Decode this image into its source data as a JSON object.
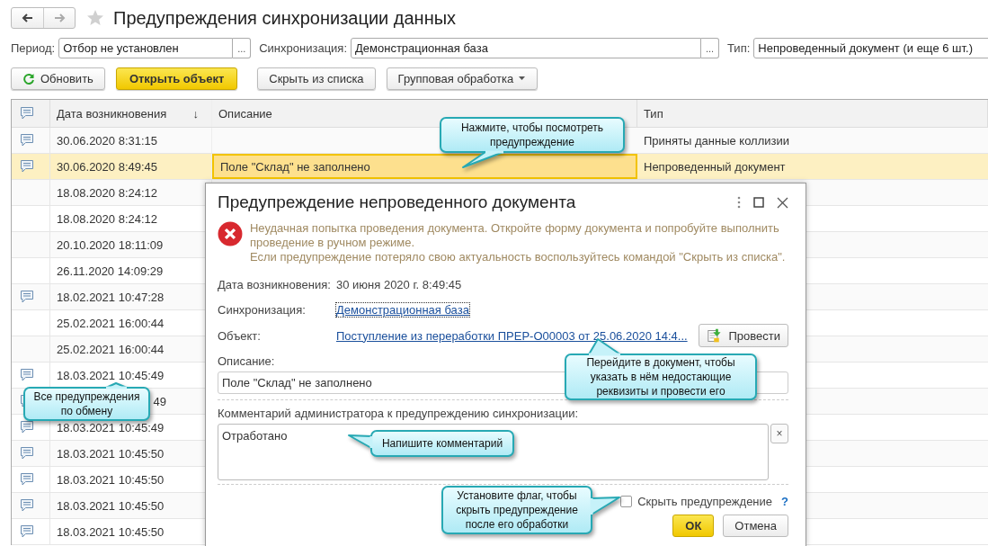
{
  "nav_buttons": [
    {
      "kind": "back",
      "disabled": false
    },
    {
      "kind": "forward",
      "disabled": true
    }
  ],
  "title": "Предупреждения синхронизации данных",
  "filters": [
    {
      "label": "Период:",
      "value": "Отбор не установлен",
      "picker": "..."
    },
    {
      "label": "Синхронизация:",
      "value": "Демонстрационная база",
      "picker": "..."
    },
    {
      "label": "Тип:",
      "value": "Непроведенный документ (и еще 6 шт.)"
    }
  ],
  "toolbar": [
    {
      "label": "Обновить",
      "kind": "refresh"
    },
    {
      "label": "Открыть объект",
      "kind": "default"
    },
    {
      "label": "Скрыть из списка",
      "kind": "plain"
    },
    {
      "label": "Групповая обработка",
      "kind": "dropdown"
    }
  ],
  "table": {
    "columns": [
      {
        "kind": "icon"
      },
      {
        "kind": "text",
        "label": "Дата возникновения",
        "sort_mark": "↓"
      },
      {
        "kind": "text",
        "label": "Описание"
      },
      {
        "kind": "text",
        "label": "Тип"
      }
    ],
    "rows": [
      {
        "kind": "full",
        "has_comment": true,
        "date": "30.06.2020 8:31:15",
        "type": "Приняты данные коллизии",
        "selected": false
      },
      {
        "kind": "full",
        "has_comment": true,
        "date": "30.06.2020 8:49:45",
        "description": "Поле \"Склад\" не заполнено",
        "type": "Непроведенный документ",
        "selected": true
      },
      {
        "kind": "full",
        "has_comment": false,
        "date": "18.08.2020 8:24:12",
        "selected": false
      },
      {
        "kind": "full",
        "has_comment": false,
        "date": "18.08.2020 8:24:12",
        "selected": false
      },
      {
        "kind": "full",
        "has_comment": false,
        "date": "20.10.2020 18:11:09",
        "selected": false
      },
      {
        "kind": "full",
        "has_comment": false,
        "date": "26.11.2020 14:09:29",
        "selected": false
      },
      {
        "kind": "full",
        "has_comment": true,
        "date": "18.02.2021 10:47:28",
        "selected": false
      },
      {
        "kind": "full",
        "has_comment": false,
        "date": "25.02.2021 16:00:44",
        "selected": false
      },
      {
        "kind": "full",
        "has_comment": false,
        "date": "25.02.2021 16:00:44",
        "selected": false
      },
      {
        "kind": "full",
        "has_comment": true,
        "date": "18.03.2021 10:45:49",
        "selected": false
      },
      {
        "kind": "covered",
        "has_comment": true,
        "date": "49",
        "selected": false
      },
      {
        "kind": "full",
        "has_comment": true,
        "date": "18.03.2021 10:45:49",
        "selected": false
      },
      {
        "kind": "full",
        "has_comment": true,
        "date": "18.03.2021 10:45:50",
        "selected": false
      },
      {
        "kind": "full",
        "has_comment": true,
        "date": "18.03.2021 10:45:50",
        "selected": false
      },
      {
        "kind": "full",
        "has_comment": true,
        "date": "18.03.2021 10:45:50",
        "selected": false
      },
      {
        "kind": "full",
        "has_comment": true,
        "date": "18.03.2021 10:45:50",
        "selected": false
      }
    ]
  },
  "dialog": {
    "title": "Предупреждение непроведенного документа",
    "message": [
      "Неудачная попытка проведения документа. Откройте форму документа и попробуйте выполнить проведение в ручном режиме.",
      "Если предупреждение потеряло свою актуальность воспользуйтесь командой \"Скрыть из списка\"."
    ],
    "date_label": "Дата возникновения:",
    "date_value": "30 июня 2020 г. 8:49:45",
    "sync_label": "Синхронизация:",
    "sync_link": "Демонстрационная база",
    "object_label": "Объект:",
    "object_link": "Поступление из переработки ПРЕР-О00003 от 25.06.2020 14:4...",
    "post_button": "Провести",
    "description_label": "Описание:",
    "description_value": "Поле \"Склад\" не заполнено",
    "comment_label": "Комментарий администратора к предупреждению синхронизации:",
    "comment_value": "Отработано",
    "clear_button": "×",
    "hide_checkbox": {
      "label": "Скрыть предупреждение",
      "checked": false
    },
    "help": "?",
    "buttons": [
      {
        "label": "ОК",
        "kind": "default"
      },
      {
        "label": "Отмена",
        "kind": "plain"
      }
    ]
  },
  "callouts": [
    {
      "text": "Нажмите, чтобы посмотреть предупреждение"
    },
    {
      "text": "Все предупреждения по обмену"
    },
    {
      "text": "Перейдите в документ, чтобы указать в нём недостающие реквизиты и провести его"
    },
    {
      "text": "Напишите комментарий"
    },
    {
      "text": "Установите флаг, чтобы скрыть предупреждение после его обработки"
    }
  ]
}
